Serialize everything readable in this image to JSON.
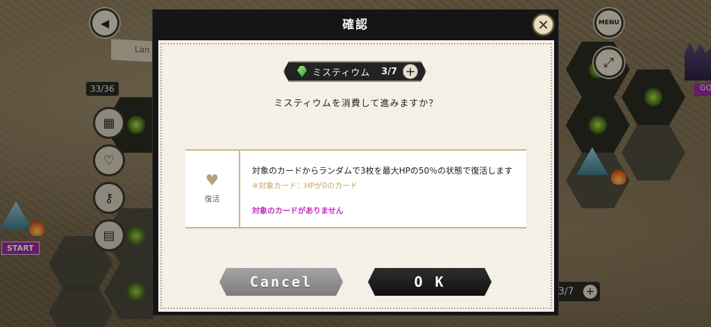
{
  "map": {
    "location_banner": "Lan",
    "stage_count": "33/36",
    "start_label": "START",
    "goal_label": "GO",
    "menu_label": "MENU",
    "right_counter": "3/7"
  },
  "dialog": {
    "title": "確認",
    "resource": {
      "name": "ミスティウム",
      "count": "3/7",
      "plus": "+"
    },
    "question": "ミスティウムを消費して進みますか？",
    "effect": {
      "label": "復活",
      "description": "対象のカードからランダムで3枚を最大HPの50％の状態で復活します",
      "note": "※対象カード：HPが0のカード",
      "warning": "対象のカードがありません"
    },
    "cancel_label": "Cancel",
    "ok_label": "O K"
  },
  "colors": {
    "accent_gold": "#c4a35e",
    "warning_magenta": "#c62bc4",
    "start_tag": "#9b2d9b"
  }
}
